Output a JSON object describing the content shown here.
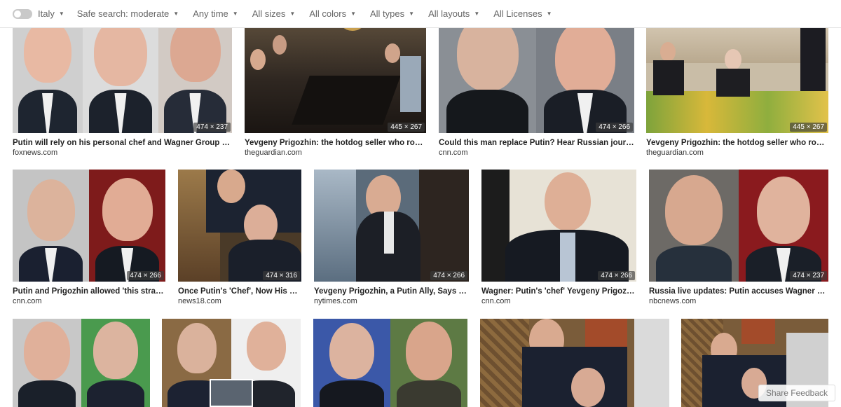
{
  "filters": {
    "region": "Italy",
    "safe_search": "Safe search: moderate",
    "time": "Any time",
    "sizes": "All sizes",
    "colors": "All colors",
    "types": "All types",
    "layouts": "All layouts",
    "licenses": "All Licenses"
  },
  "results": [
    {
      "title": "Putin will rely on his personal chef and Wagner Group hea...",
      "source": "foxnews.com",
      "dims": "474 × 237"
    },
    {
      "title": "Yevgeny Prigozhin: the hotdog seller who rose t...",
      "source": "theguardian.com",
      "dims": "445 × 267"
    },
    {
      "title": "Could this man replace Putin? Hear Russian journali...",
      "source": "cnn.com",
      "dims": "474 × 266"
    },
    {
      "title": "Yevgeny Prigozhin: the hotdog seller who rose t...",
      "source": "theguardian.com",
      "dims": "445 × 267"
    },
    {
      "title": "Putin and Prigozhin allowed 'this strate...",
      "source": "cnn.com",
      "dims": "474 × 266"
    },
    {
      "title": "Once Putin's 'Chef', Now His Fir...",
      "source": "news18.com",
      "dims": "474 × 316"
    },
    {
      "title": "Yevgeny Prigozhin, a Putin Ally, Says He ...",
      "source": "nytimes.com",
      "dims": "474 × 266"
    },
    {
      "title": "Wagner: Putin's 'chef' Yevgeny Prigozhin...",
      "source": "cnn.com",
      "dims": "474 × 266"
    },
    {
      "title": "Russia live updates: Putin accuses Wagner chie...",
      "source": "nbcnews.com",
      "dims": "474 × 237"
    }
  ],
  "feedback": "Share Feedback"
}
